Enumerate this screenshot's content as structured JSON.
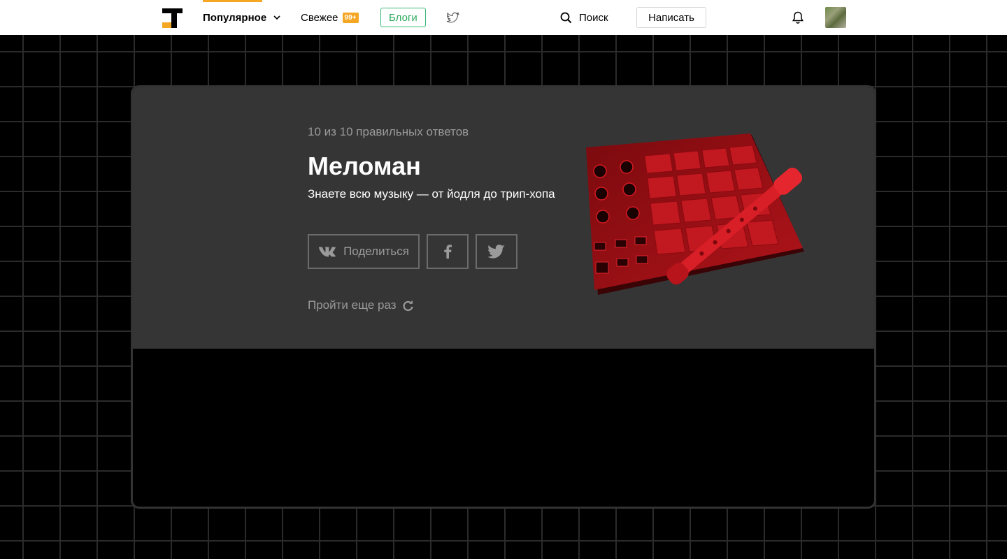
{
  "header": {
    "nav_popular": "Популярное",
    "nav_fresh": "Свежее",
    "fresh_badge": "99+",
    "blogs": "Блоги",
    "search": "Поиск",
    "write": "Написать"
  },
  "result": {
    "score": "10 из 10 правильных ответов",
    "title": "Меломан",
    "subtitle": "Знаете всю музыку — от йодля до трип-хопа",
    "share_vk": "Поделиться",
    "retry": "Пройти еще раз"
  },
  "colors": {
    "accent": "#f5a623",
    "blogs_green": "#2eaa5e",
    "card_bg": "#353535",
    "illustration_red": "#c0121a"
  },
  "icons": [
    "tj-logo-icon",
    "chevron-down-icon",
    "twitter-icon",
    "search-icon",
    "bell-icon",
    "vk-icon",
    "facebook-icon",
    "refresh-icon"
  ]
}
